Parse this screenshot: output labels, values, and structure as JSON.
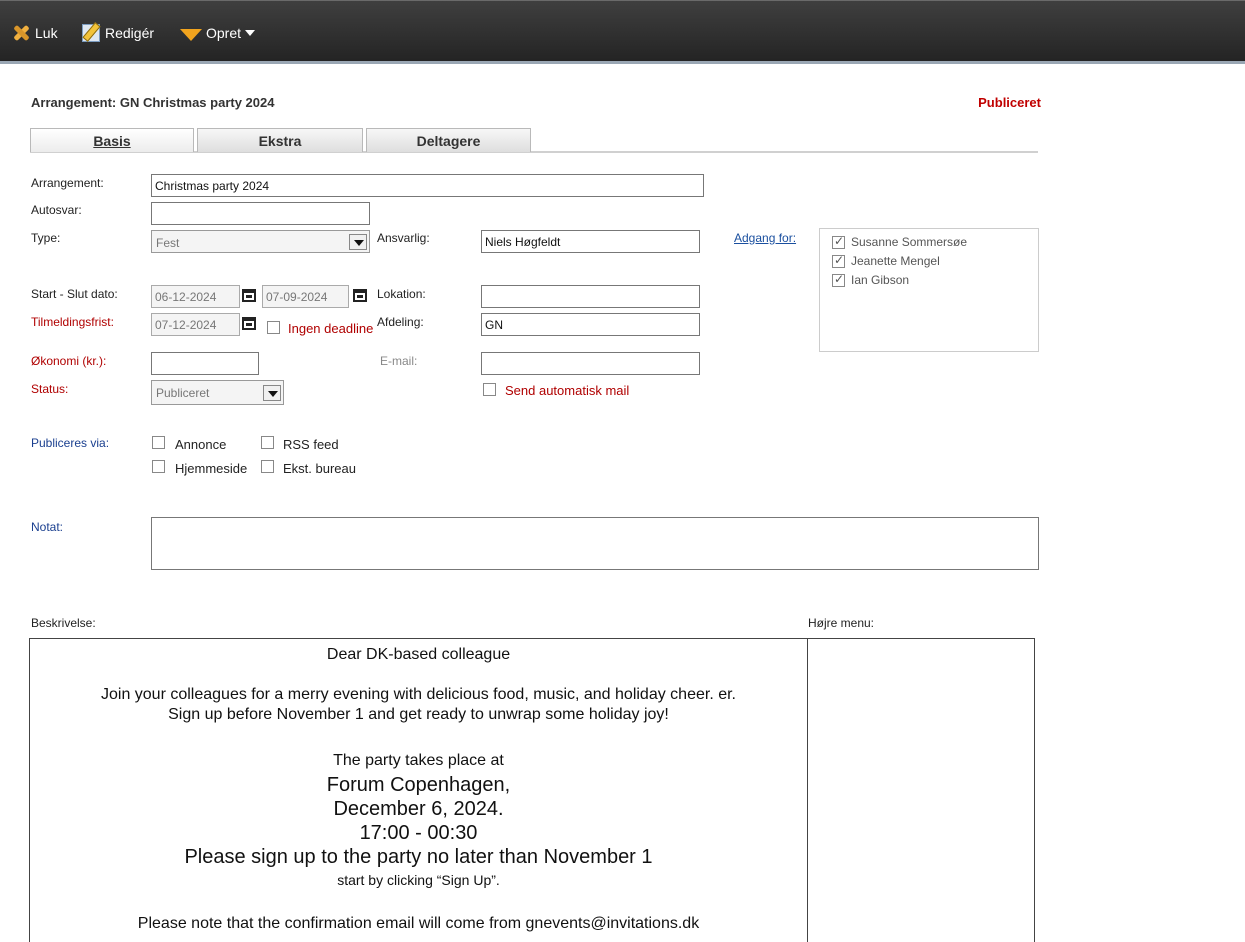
{
  "toolbar": {
    "close_label": "Luk",
    "edit_label": "Redigér",
    "create_label": "Opret"
  },
  "header": {
    "title": "Arrangement: GN Christmas party 2024",
    "status": "Publiceret"
  },
  "tabs": [
    {
      "label": "Basis",
      "active": true
    },
    {
      "label": "Ekstra",
      "active": false
    },
    {
      "label": "Deltagere",
      "active": false
    }
  ],
  "form": {
    "arrangement_label": "Arrangement:",
    "arrangement_value": "Christmas party 2024",
    "autosvar_label": "Autosvar:",
    "autosvar_value": "",
    "type_label": "Type:",
    "type_value": "Fest",
    "ansvarlig_label": "Ansvarlig:",
    "ansvarlig_value": "Niels Høgfeldt",
    "adgang_label": "Adgang for:",
    "access_list": [
      {
        "name": "Susanne Sommersøe",
        "checked": true
      },
      {
        "name": "Jeanette Mengel",
        "checked": true
      },
      {
        "name": "Ian Gibson",
        "checked": true
      }
    ],
    "dates_label": "Start - Slut dato:",
    "start_date": "06-12-2024",
    "end_date": "07-09-2024",
    "lokation_label": "Lokation:",
    "lokation_value": "",
    "deadline_label": "Tilmeldingsfrist:",
    "deadline_value": "07-12-2024",
    "no_deadline_label": "Ingen deadline",
    "afdeling_label": "Afdeling:",
    "afdeling_value": "GN",
    "economy_label": "Økonomi (kr.):",
    "economy_value": "",
    "email_label": "E-mail:",
    "email_value": "",
    "status_label": "Status:",
    "status_value": "Publiceret",
    "auto_mail_label": "Send automatisk mail",
    "publish_label": "Publiceres via:",
    "publish_options": {
      "annonce": "Annonce",
      "rss": "RSS feed",
      "hjemmeside": "Hjemmeside",
      "bureau": "Ekst. bureau"
    },
    "note_label": "Notat:"
  },
  "description": {
    "label": "Beskrivelse:",
    "right_menu_label": "Højre menu:",
    "line1": "Dear DK-based colleague",
    "line2": "Join your  colleagues for a merry evening with delicious food, music, and holiday cheer.  er.",
    "line3": "Sign up before November 1 and get ready to unwrap some holiday joy!",
    "line4": "The party takes place at",
    "line5": "Forum Copenhagen,",
    "line6": "December 6, 2024.",
    "line7": "17:00 - 00:30",
    "line8": "Please sign up to the party no later than November 1",
    "line9": "start by clicking “Sign Up”.",
    "line10": "Please note that the confirmation email will come from gnevents@invitations.dk"
  }
}
